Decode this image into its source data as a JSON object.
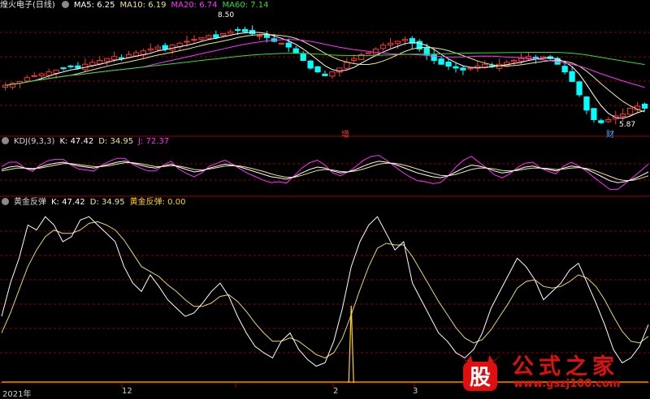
{
  "panels": {
    "main": {
      "title": "煌火电子(日线)",
      "ma": [
        {
          "label": "MA5: 6.25",
          "color": "#ffffff"
        },
        {
          "label": "MA10: 6.19",
          "color": "#f0e68c"
        },
        {
          "label": "MA20: 6.74",
          "color": "#ff30ff"
        },
        {
          "label": "MA60: 7.14",
          "color": "#33dd33"
        }
      ],
      "high_label": "8.50",
      "low_label": "5.87",
      "mark_zeng": "增",
      "mark_cai": "财"
    },
    "kdj": {
      "title": "KDJ(9,3,3)",
      "k_label": "K: 47.42",
      "d_label": "D: 34.95",
      "j_label": "J: 72.37"
    },
    "gold": {
      "title": "黄金反弹",
      "k_label": "K: 47.42",
      "d_label": "D: 34.95",
      "g_label": "黄金反弹: 0.00"
    }
  },
  "x_axis": {
    "labels": [
      "2021年",
      "12",
      "2",
      "3"
    ]
  },
  "watermark": {
    "logo_char": "股",
    "title": "公式之家",
    "url": "www.gszj100.com"
  },
  "colors": {
    "up": "#ff3333",
    "down": "#00ffff",
    "ma5": "#ffffff",
    "ma10": "#f0e68c",
    "ma20": "#ff30ff",
    "ma60": "#33dd33",
    "grid": "#8b0000"
  },
  "chart_data": {
    "type": "line",
    "candles": {
      "note": "daily price, y in price units",
      "close": [
        6.85,
        6.9,
        6.95,
        7.05,
        7.1,
        7.15,
        7.2,
        7.25,
        7.3,
        7.35,
        7.3,
        7.4,
        7.45,
        7.5,
        7.55,
        7.6,
        7.55,
        7.65,
        7.7,
        7.75,
        7.8,
        7.85,
        7.8,
        7.9,
        7.95,
        8.0,
        8.05,
        8.1,
        8.15,
        8.1,
        8.2,
        8.25,
        8.3,
        8.25,
        8.2,
        8.15,
        8.1,
        8.0,
        7.95,
        7.85,
        7.7,
        7.5,
        7.3,
        7.2,
        7.1,
        7.2,
        7.3,
        7.45,
        7.55,
        7.65,
        7.7,
        7.8,
        7.9,
        7.95,
        8.0,
        8.05,
        7.95,
        7.8,
        7.65,
        7.5,
        7.4,
        7.35,
        7.3,
        7.25,
        7.3,
        7.35,
        7.4,
        7.35,
        7.4,
        7.45,
        7.5,
        7.55,
        7.6,
        7.55,
        7.6,
        7.55,
        7.4,
        7.2,
        6.95,
        6.6,
        6.2,
        5.95,
        5.87,
        5.95,
        6.05,
        6.1,
        6.25,
        6.3,
        6.25
      ]
    },
    "series": [
      {
        "name": "MA5",
        "values": "computed"
      },
      {
        "name": "MA10",
        "values": "computed"
      },
      {
        "name": "MA20",
        "values": "computed"
      },
      {
        "name": "MA60",
        "values": "computed"
      }
    ],
    "kdj": {
      "K": [
        55,
        60,
        62,
        58,
        55,
        60,
        65,
        68,
        70,
        66,
        62,
        60,
        58,
        62,
        66,
        70,
        72,
        68,
        64,
        60,
        58,
        62,
        66,
        60,
        55,
        50,
        52,
        58,
        62,
        66,
        64,
        60,
        55,
        50,
        45,
        40,
        38,
        35,
        40,
        48,
        55,
        60,
        58,
        52,
        48,
        50,
        55,
        62,
        68,
        72,
        70,
        66,
        60,
        54,
        48,
        44,
        40,
        38,
        42,
        50,
        58,
        64,
        62,
        58,
        52,
        48,
        50,
        55,
        60,
        62,
        58,
        55,
        52,
        58,
        62,
        60,
        55,
        48,
        40,
        32,
        28,
        30,
        35,
        42,
        50
      ],
      "D": [
        52,
        55,
        58,
        58,
        57,
        58,
        61,
        64,
        67,
        67,
        65,
        63,
        61,
        61,
        63,
        66,
        69,
        69,
        67,
        64,
        61,
        61,
        63,
        62,
        59,
        55,
        54,
        56,
        59,
        62,
        63,
        62,
        59,
        55,
        51,
        46,
        42,
        39,
        39,
        43,
        48,
        53,
        55,
        54,
        51,
        50,
        52,
        56,
        61,
        66,
        68,
        68,
        65,
        61,
        56,
        51,
        47,
        43,
        42,
        45,
        50,
        55,
        58,
        58,
        56,
        53,
        52,
        53,
        56,
        58,
        58,
        57,
        55,
        56,
        58,
        59,
        57,
        53,
        47,
        41,
        35,
        32,
        33,
        37,
        42
      ],
      "J": [
        61,
        70,
        70,
        58,
        51,
        64,
        73,
        76,
        76,
        64,
        56,
        54,
        52,
        64,
        72,
        78,
        78,
        66,
        58,
        52,
        52,
        64,
        72,
        56,
        47,
        40,
        48,
        62,
        68,
        74,
        66,
        56,
        47,
        40,
        33,
        28,
        30,
        27,
        42,
        58,
        69,
        74,
        64,
        48,
        42,
        50,
        61,
        74,
        82,
        84,
        74,
        62,
        50,
        40,
        32,
        30,
        26,
        28,
        42,
        60,
        74,
        82,
        70,
        58,
        44,
        38,
        46,
        59,
        68,
        70,
        58,
        51,
        46,
        62,
        70,
        62,
        51,
        38,
        26,
        14,
        14,
        26,
        39,
        52,
        66
      ]
    },
    "gold_rebound": {
      "K": [
        40,
        60,
        75,
        95,
        92,
        100,
        95,
        85,
        88,
        98,
        100,
        95,
        90,
        85,
        70,
        60,
        55,
        65,
        58,
        50,
        45,
        40,
        42,
        48,
        55,
        60,
        52,
        40,
        30,
        22,
        18,
        15,
        25,
        30,
        20,
        14,
        10,
        12,
        25,
        45,
        70,
        85,
        95,
        100,
        90,
        80,
        85,
        60,
        50,
        40,
        30,
        25,
        18,
        15,
        20,
        30,
        45,
        55,
        65,
        75,
        70,
        62,
        50,
        55,
        60,
        68,
        72,
        60,
        48,
        35,
        20,
        12,
        15,
        22,
        35
      ],
      "D": [
        30,
        42,
        56,
        70,
        80,
        88,
        92,
        90,
        90,
        92,
        96,
        97,
        95,
        92,
        86,
        78,
        70,
        67,
        64,
        59,
        55,
        50,
        46,
        46,
        48,
        52,
        53,
        49,
        43,
        36,
        30,
        25,
        25,
        27,
        25,
        21,
        17,
        15,
        18,
        27,
        41,
        56,
        70,
        81,
        84,
        83,
        83,
        76,
        67,
        58,
        49,
        41,
        33,
        27,
        24,
        26,
        32,
        40,
        48,
        57,
        61,
        62,
        58,
        57,
        58,
        61,
        65,
        63,
        58,
        50,
        40,
        31,
        25,
        24,
        28
      ],
      "signal": [
        {
          "index": 40,
          "value": 1
        }
      ],
      "ylim": [
        0,
        105
      ]
    }
  }
}
